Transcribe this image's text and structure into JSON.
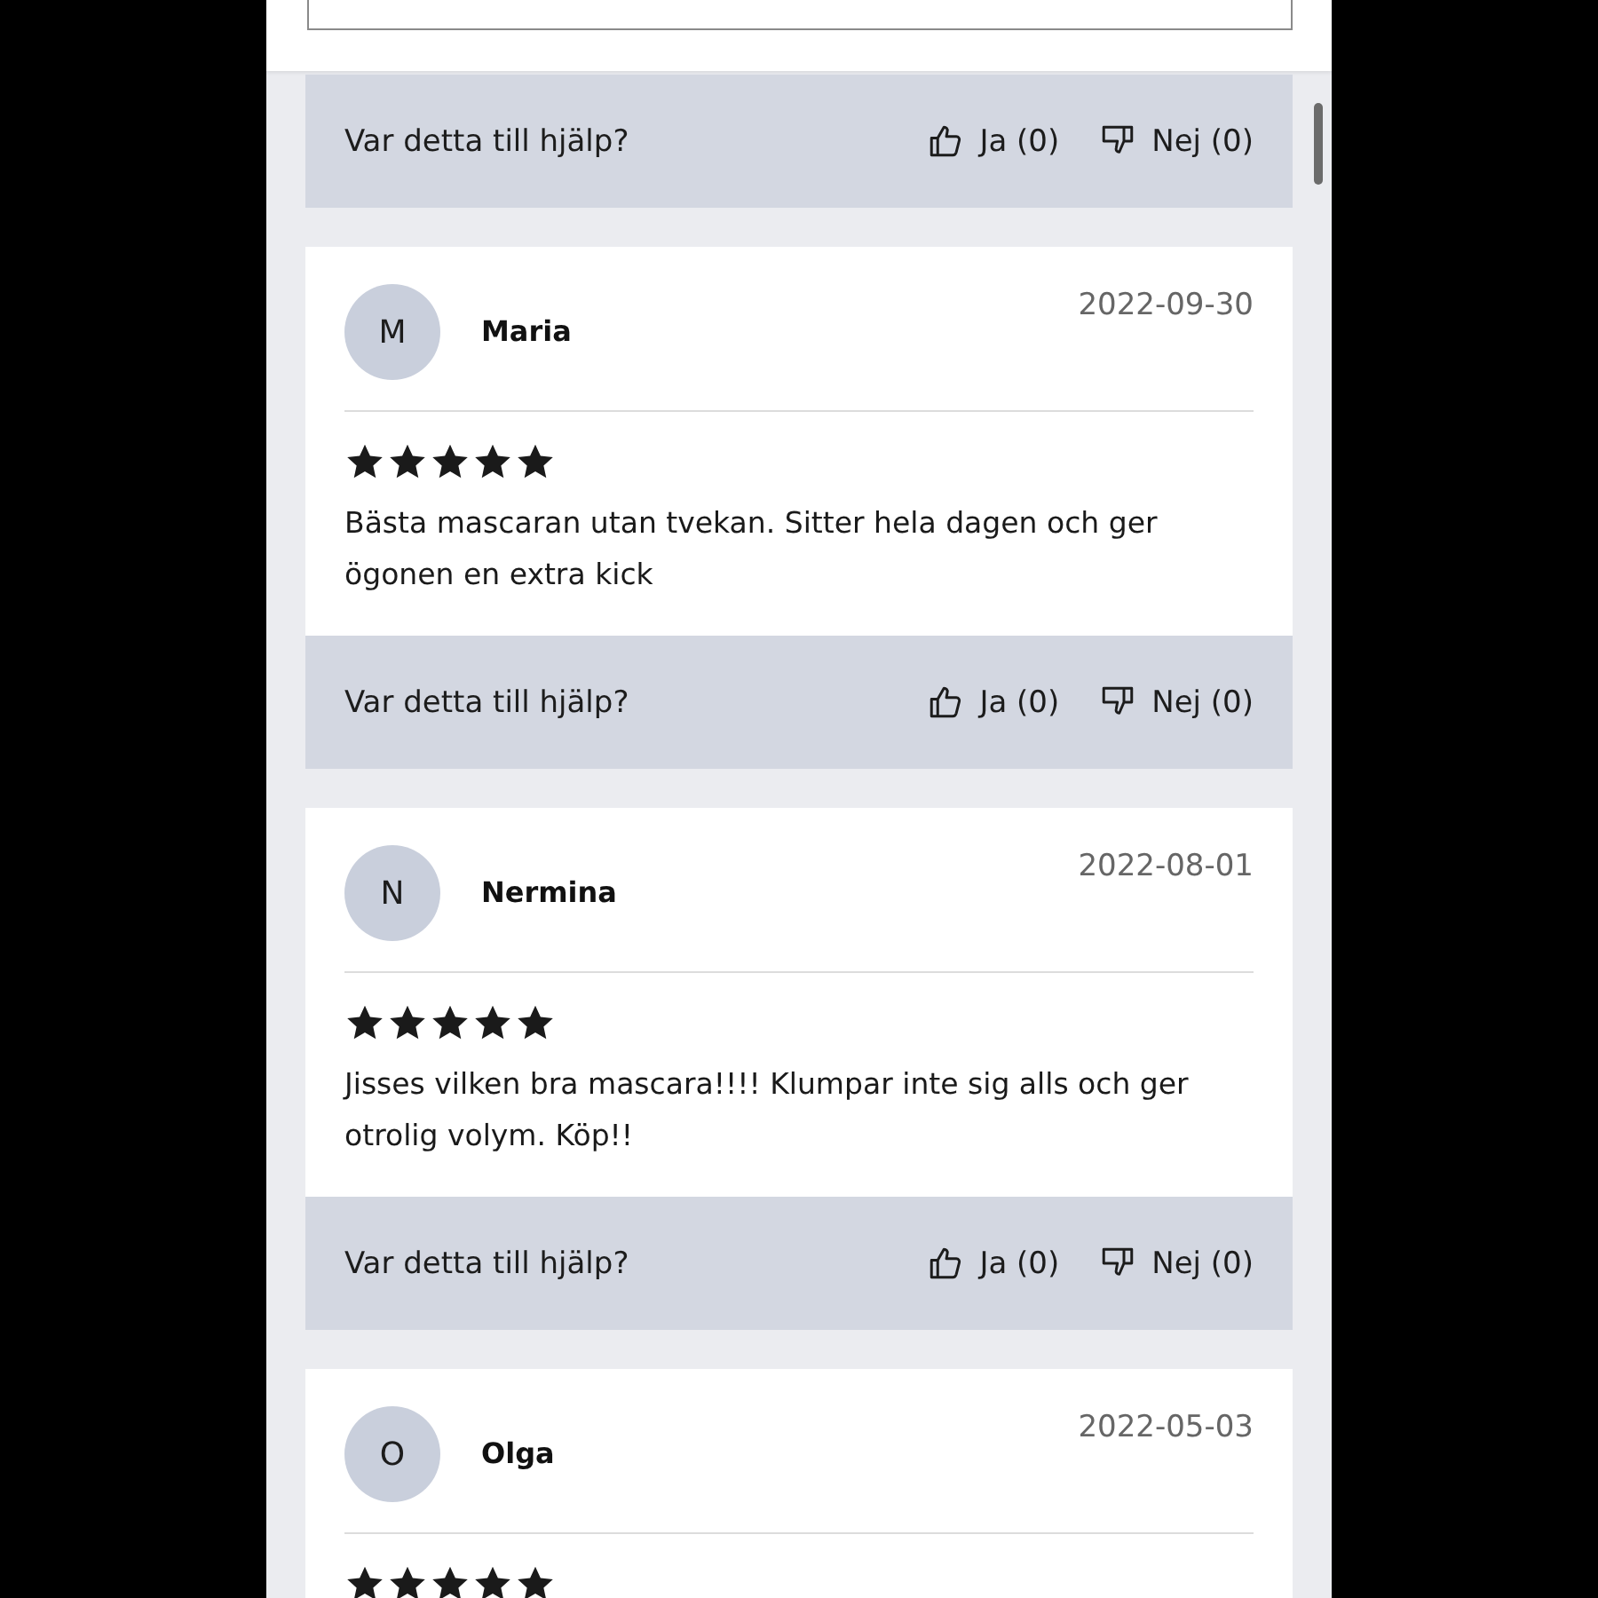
{
  "reviews": [
    {
      "feedback": {
        "question": "Var detta till hjälp?",
        "yes": "Ja (0)",
        "no": "Nej (0)"
      }
    },
    {
      "initial": "M",
      "author": "Maria",
      "date": "2022-09-30",
      "stars": 5,
      "text": "Bästa mascaran utan tvekan. Sitter hela dagen och ger ögonen en extra kick",
      "feedback": {
        "question": "Var detta till hjälp?",
        "yes": "Ja (0)",
        "no": "Nej (0)"
      }
    },
    {
      "initial": "N",
      "author": "Nermina",
      "date": "2022-08-01",
      "stars": 5,
      "text": "Jisses vilken bra mascara!!!! Klumpar inte sig alls och ger otrolig volym. Köp!!",
      "feedback": {
        "question": "Var detta till hjälp?",
        "yes": "Ja (0)",
        "no": "Nej (0)"
      }
    },
    {
      "initial": "O",
      "author": "Olga",
      "date": "2022-05-03",
      "stars": 5
    }
  ]
}
